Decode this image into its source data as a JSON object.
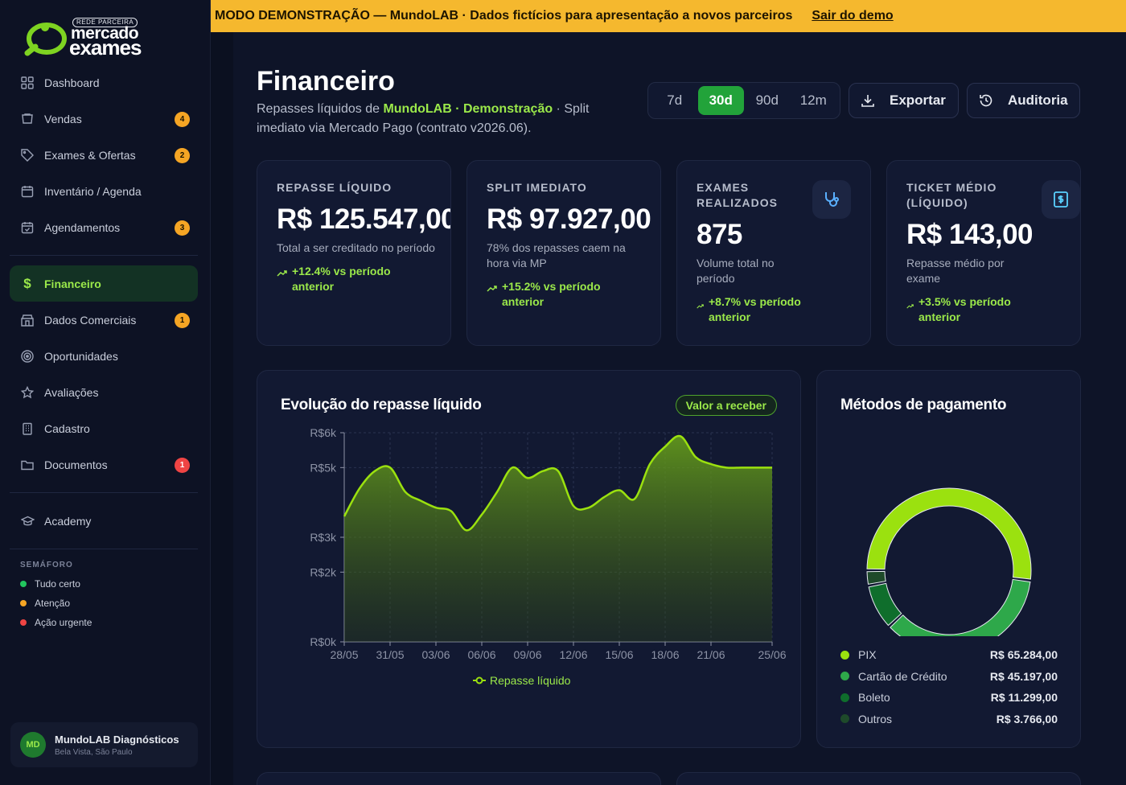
{
  "brand": {
    "badge": "REDE PARCEIRA",
    "line1": "mercado",
    "line2": "exames"
  },
  "sidebar": {
    "items": [
      {
        "label": "Dashboard",
        "icon": "dashboard-icon",
        "badge": ""
      },
      {
        "label": "Vendas",
        "icon": "cart-icon",
        "badge": "4"
      },
      {
        "label": "Exames & Ofertas",
        "icon": "tag-icon",
        "badge": "2"
      },
      {
        "label": "Inventário / Agenda",
        "icon": "calendar-icon",
        "badge": ""
      },
      {
        "label": "Agendamentos",
        "icon": "calendar-check-icon",
        "badge": "3"
      },
      {
        "label": "Financeiro",
        "icon": "dollar-icon",
        "badge": ""
      },
      {
        "label": "Dados Comerciais",
        "icon": "store-icon",
        "badge": "1"
      },
      {
        "label": "Oportunidades",
        "icon": "target-icon",
        "badge": ""
      },
      {
        "label": "Avaliações",
        "icon": "star-icon",
        "badge": ""
      },
      {
        "label": "Cadastro",
        "icon": "building-icon",
        "badge": ""
      },
      {
        "label": "Documentos",
        "icon": "folder-icon",
        "badge": "1"
      },
      {
        "label": "Academy",
        "icon": "graduation-cap-icon",
        "badge": ""
      }
    ],
    "semaforo": {
      "title": "SEMÁFORO",
      "items": [
        {
          "label": "Tudo certo",
          "color": "#22c55e"
        },
        {
          "label": "Atenção",
          "color": "#f5a524"
        },
        {
          "label": "Ação urgente",
          "color": "#ef4444"
        }
      ]
    },
    "user": {
      "initials": "MD",
      "name": "MundoLAB Diagnósticos",
      "location": "Bela Vista, São Paulo"
    }
  },
  "banner": {
    "text": "MODO DEMONSTRAÇÃO — MundoLAB · Dados fictícios para apresentação a novos parceiros",
    "exit": "Sair do demo"
  },
  "header": {
    "title": "Financeiro",
    "subtitle_pre": "Repasses líquidos de ",
    "subtitle_hl": "MundoLAB · Demonstração",
    "subtitle_post": " · Split imediato via Mercado Pago (contrato v2026.06).",
    "periods": [
      "7d",
      "30d",
      "90d",
      "12m"
    ],
    "active_period": "30d",
    "export_label": "Exportar",
    "audit_label": "Auditoria"
  },
  "kpis": [
    {
      "label": "REPASSE LÍQUIDO",
      "value": "R$ 125.547,00",
      "desc": "Total a ser creditado no período",
      "trend": "+12.4% vs período anterior"
    },
    {
      "label": "SPLIT IMEDIATO",
      "value": "R$ 97.927,00",
      "desc": "78% dos repasses caem na hora via MP",
      "trend": "+15.2% vs período anterior"
    },
    {
      "label": "EXAMES REALIZADOS",
      "value": "875",
      "desc": "Volume total no período",
      "trend": "+8.7% vs período anterior"
    },
    {
      "label": "TICKET MÉDIO (LÍQUIDO)",
      "value": "R$ 143,00",
      "desc": "Repasse médio por exame",
      "trend": "+3.5% vs período anterior"
    }
  ],
  "colors": {
    "accent": "#9be94a",
    "primary_green": "#22a33a",
    "warning": "#f5b82e"
  },
  "chart_data": [
    {
      "type": "area",
      "title": "Evolução do repasse líquido",
      "badge": "Valor a receber",
      "x_ticks": [
        "28/05",
        "31/05",
        "03/06",
        "06/06",
        "09/06",
        "12/06",
        "15/06",
        "18/06",
        "21/06",
        "25/06"
      ],
      "y_ticks": [
        "R$0k",
        "R$2k",
        "R$3k",
        "R$5k",
        "R$6k"
      ],
      "ylim": [
        0,
        6000
      ],
      "x": [
        "28/05",
        "29/05",
        "30/05",
        "31/05",
        "01/06",
        "02/06",
        "03/06",
        "04/06",
        "05/06",
        "06/06",
        "07/06",
        "08/06",
        "09/06",
        "10/06",
        "11/06",
        "12/06",
        "13/06",
        "14/06",
        "15/06",
        "16/06",
        "17/06",
        "18/06",
        "19/06",
        "20/06",
        "21/06",
        "22/06",
        "23/06",
        "24/06",
        "25/06"
      ],
      "series": [
        {
          "name": "Repasse líquido",
          "values": [
            3600,
            4400,
            4900,
            5000,
            4300,
            4050,
            3850,
            3750,
            3200,
            3650,
            4300,
            5000,
            4700,
            4900,
            4900,
            3900,
            3850,
            4150,
            4350,
            4100,
            5100,
            5600,
            5900,
            5300,
            5100,
            5000,
            5000,
            5000,
            5000
          ]
        }
      ],
      "grid": true
    },
    {
      "type": "pie",
      "title": "Métodos de pagamento",
      "slices": [
        {
          "label": "PIX",
          "value": 65284,
          "display": "R$ 65.284,00",
          "color": "#9be10f"
        },
        {
          "label": "Cartão de Crédito",
          "value": 45197,
          "display": "R$ 45.197,00",
          "color": "#2ea84a"
        },
        {
          "label": "Boleto",
          "value": 11299,
          "display": "R$ 11.299,00",
          "color": "#0f6e2c"
        },
        {
          "label": "Outros",
          "value": 3766,
          "display": "R$ 3.766,00",
          "color": "#1e4a2a"
        }
      ]
    }
  ]
}
